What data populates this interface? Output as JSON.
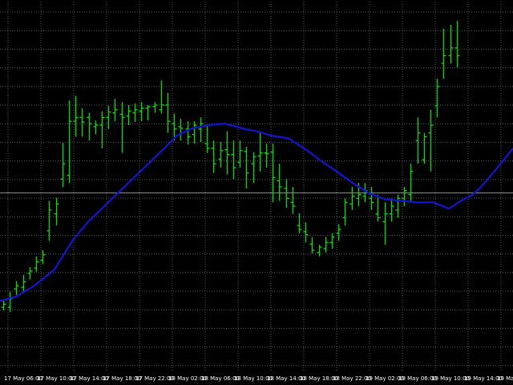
{
  "colors": {
    "background": "#000000",
    "grid": "#5a5a5a",
    "price_bars": "#00e000",
    "moving_average": "#1414d2",
    "axis_labels": "#ffffff",
    "horizontal_level": "#8c8c8c"
  },
  "chart_data": {
    "type": "line",
    "grid": true,
    "grid_style": "dotted",
    "title": "",
    "xlabel": "",
    "ylabel": "",
    "x_tick_labels": [
      "17 May 06:00",
      "17 May 10:00",
      "17 May 14:00",
      "17 May 18:00",
      "17 May 22:00",
      "18 May 02:00",
      "18 May 06:00",
      "18 May 10:00",
      "18 May 14:00",
      "18 May 18:00",
      "18 May 22:00",
      "19 May 02:00",
      "19 May 06:00",
      "19 May 10:00",
      "19 May 14:00",
      "19 Ma"
    ],
    "ylim": [
      0,
      480
    ],
    "horizontal_level": 233,
    "series": [
      {
        "kind": "ohlc_bars",
        "bars": [
          [
            84,
            94,
            80,
            88
          ],
          [
            84,
            104,
            78,
            95
          ],
          [
            108,
            118,
            100,
            112
          ],
          [
            110,
            126,
            104,
            117
          ],
          [
            128,
            136,
            120,
            131
          ],
          [
            135,
            150,
            130,
            143
          ],
          [
            145,
            158,
            140,
            152
          ],
          [
            183,
            222,
            170,
            210
          ],
          [
            205,
            226,
            190,
            218
          ],
          [
            250,
            297,
            240,
            270
          ],
          [
            255,
            352,
            245,
            325
          ],
          [
            325,
            358,
            305,
            330
          ],
          [
            330,
            342,
            305,
            324
          ],
          [
            330,
            336,
            300,
            322
          ],
          [
            318,
            326,
            308,
            320
          ],
          [
            320,
            338,
            290,
            330
          ],
          [
            330,
            345,
            315,
            337
          ],
          [
            336,
            354,
            325,
            340
          ],
          [
            334,
            350,
            284,
            330
          ],
          [
            332,
            346,
            320,
            338
          ],
          [
            336,
            348,
            324,
            340
          ],
          [
            338,
            350,
            325,
            342
          ],
          [
            342,
            346,
            326,
            344
          ],
          [
            344,
            350,
            336,
            346
          ],
          [
            340,
            378,
            335,
            346
          ],
          [
            346,
            362,
            310,
            325
          ],
          [
            322,
            335,
            300,
            315
          ],
          [
            318,
            328,
            300,
            316
          ],
          [
            315,
            325,
            295,
            305
          ],
          [
            308,
            325,
            296,
            320
          ],
          [
            315,
            330,
            298,
            322
          ],
          [
            296,
            320,
            284,
            290
          ],
          [
            290,
            300,
            258,
            270
          ],
          [
            276,
            298,
            265,
            287
          ],
          [
            288,
            312,
            256,
            282
          ],
          [
            282,
            300,
            250,
            265
          ],
          [
            272,
            300,
            265,
            287
          ],
          [
            286,
            292,
            238,
            258
          ],
          [
            270,
            285,
            245,
            279
          ],
          [
            280,
            312,
            260,
            284
          ],
          [
            284,
            296,
            265,
            283
          ],
          [
            285,
            296,
            220,
            252
          ],
          [
            248,
            270,
            222,
            240
          ],
          [
            238,
            250,
            213,
            225
          ],
          [
            220,
            240,
            205,
            215
          ],
          [
            190,
            206,
            180,
            185
          ],
          [
            182,
            194,
            168,
            178
          ],
          [
            166,
            175,
            154,
            158
          ],
          [
            155,
            165,
            150,
            162
          ],
          [
            160,
            175,
            155,
            168
          ],
          [
            168,
            180,
            160,
            175
          ],
          [
            180,
            192,
            170,
            185
          ],
          [
            200,
            225,
            190,
            220
          ],
          [
            218,
            240,
            210,
            228
          ],
          [
            225,
            245,
            215,
            230
          ],
          [
            228,
            245,
            220,
            235
          ],
          [
            225,
            240,
            210,
            220
          ],
          [
            205,
            230,
            195,
            200
          ],
          [
            195,
            220,
            165,
            205
          ],
          [
            205,
            225,
            195,
            215
          ],
          [
            210,
            230,
            200,
            225
          ],
          [
            225,
            240,
            215,
            235
          ],
          [
            230,
            270,
            220,
            260
          ],
          [
            300,
            330,
            270,
            310
          ],
          [
            275,
            310,
            270,
            305
          ],
          [
            310,
            340,
            260,
            320
          ],
          [
            345,
            380,
            330,
            370
          ],
          [
            400,
            445,
            380,
            410
          ],
          [
            410,
            450,
            400,
            420
          ],
          [
            420,
            455,
            395,
            410
          ]
        ]
      },
      {
        "kind": "moving_average",
        "x": [
          0,
          20,
          40,
          55,
          68,
          90,
          110,
          130,
          150,
          170,
          190,
          205,
          220,
          240,
          260,
          280,
          295,
          305,
          320,
          340,
          360,
          370,
          385,
          400,
          420,
          440,
          460,
          480,
          500,
          520,
          540,
          560,
          575,
          590,
          600,
          615,
          630,
          640
        ],
        "values": [
          92,
          98,
          110,
          122,
          133,
          170,
          195,
          215,
          235,
          255,
          275,
          290,
          306,
          316,
          320,
          322,
          318,
          315,
          312,
          306,
          303,
          296,
          286,
          274,
          260,
          245,
          232,
          224,
          222,
          220,
          220,
          212,
          222,
          230,
          240,
          258,
          277,
          290
        ]
      }
    ]
  }
}
